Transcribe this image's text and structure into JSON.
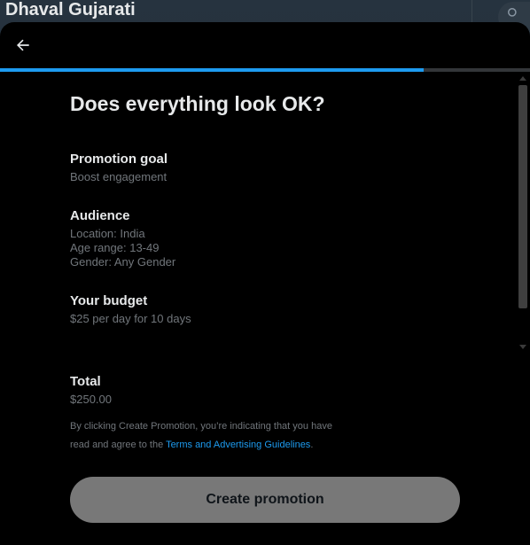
{
  "background": {
    "profile_name": "Dhaval Gujarati"
  },
  "modal": {
    "title": "Does everything look OK?",
    "progress_fraction": 0.8,
    "sections": {
      "goal": {
        "title": "Promotion goal",
        "value": "Boost engagement"
      },
      "audience": {
        "title": "Audience",
        "location": "Location: India",
        "age": "Age range: 13-49",
        "gender": "Gender: Any Gender"
      },
      "budget": {
        "title": "Your budget",
        "value": "$25 per day for 10 days"
      }
    },
    "total": {
      "title": "Total",
      "value": "$250.00"
    },
    "legal": {
      "prefix": "By clicking Create Promotion, you’re indicating that you have read and agree to the ",
      "link": "Terms and Advertising Guidelines",
      "suffix": "."
    },
    "create_button": "Create promotion"
  },
  "colors": {
    "accent": "#1d9bf0",
    "button_disabled": "#787878",
    "muted_text": "#71767b"
  },
  "icons": [
    "back-arrow-icon",
    "search-icon"
  ]
}
